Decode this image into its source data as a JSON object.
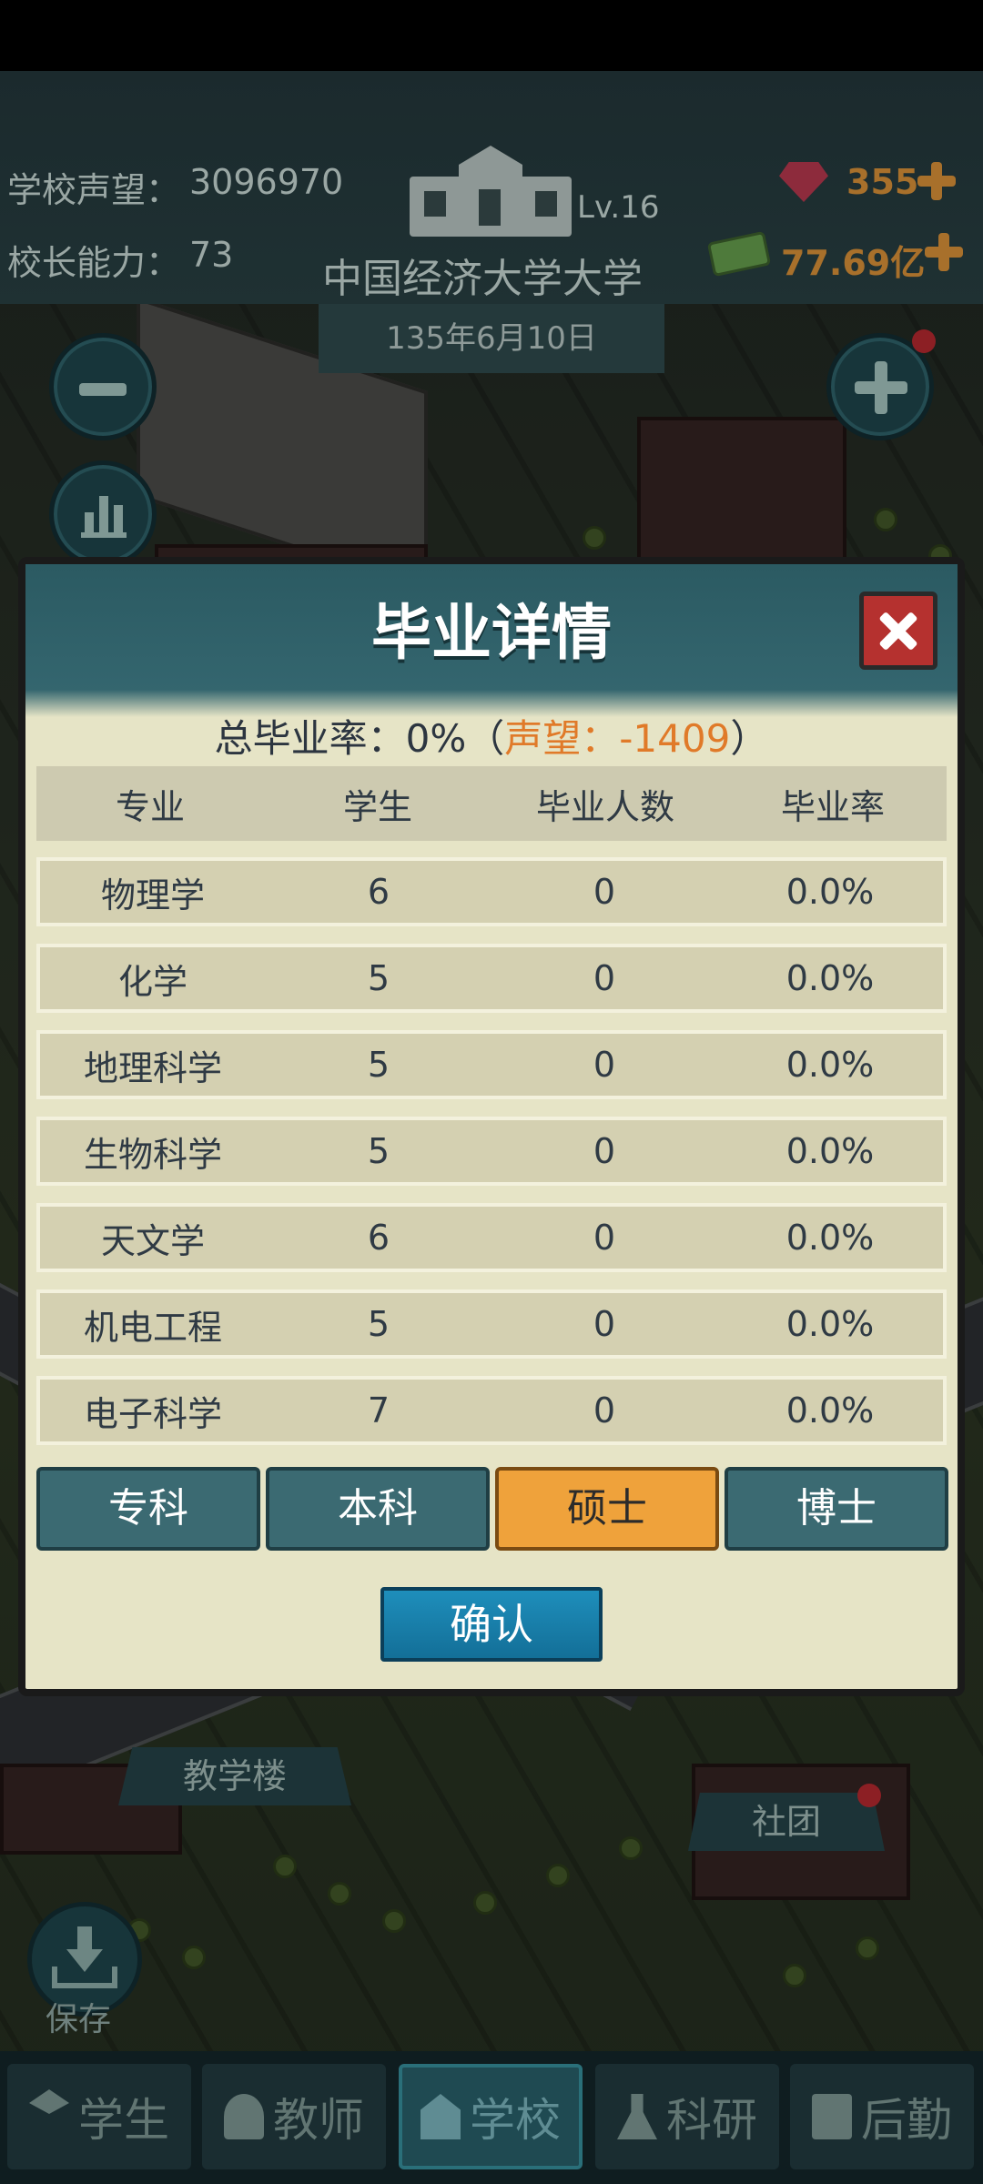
{
  "header": {
    "reputation_label": "学校声望：",
    "reputation_value": "3096970",
    "principal_label": "校长能力：",
    "principal_value": "73",
    "school_name": "中国经济大学大学",
    "level": "Lv.16",
    "date": "135年6月10日",
    "gems": "355",
    "money": "77.69亿"
  },
  "map": {
    "label_teaching": "教学楼",
    "label_club": "社团",
    "save_label": "保存"
  },
  "dialog": {
    "title": "毕业详情",
    "summary_prefix": "总毕业率：0%（",
    "summary_reputation": "声望：-1409",
    "summary_suffix": "）",
    "columns": [
      "专业",
      "学生",
      "毕业人数",
      "毕业率"
    ],
    "rows": [
      {
        "major": "物理学",
        "students": "6",
        "graduates": "0",
        "rate": "0.0%"
      },
      {
        "major": "化学",
        "students": "5",
        "graduates": "0",
        "rate": "0.0%"
      },
      {
        "major": "地理科学",
        "students": "5",
        "graduates": "0",
        "rate": "0.0%"
      },
      {
        "major": "生物科学",
        "students": "5",
        "graduates": "0",
        "rate": "0.0%"
      },
      {
        "major": "天文学",
        "students": "6",
        "graduates": "0",
        "rate": "0.0%"
      },
      {
        "major": "机电工程",
        "students": "5",
        "graduates": "0",
        "rate": "0.0%"
      },
      {
        "major": "电子科学",
        "students": "7",
        "graduates": "0",
        "rate": "0.0%"
      }
    ],
    "tabs": [
      "专科",
      "本科",
      "硕士",
      "博士"
    ],
    "active_tab": "硕士",
    "confirm": "确认"
  },
  "bottom_nav": {
    "items": [
      "学生",
      "教师",
      "学校",
      "科研",
      "后勤"
    ],
    "active": "学校"
  },
  "colors": {
    "accent_orange": "#efa23b",
    "reputation_orange": "#e07a29",
    "confirm_blue": "#1e8ebb",
    "close_red": "#b5312f"
  }
}
